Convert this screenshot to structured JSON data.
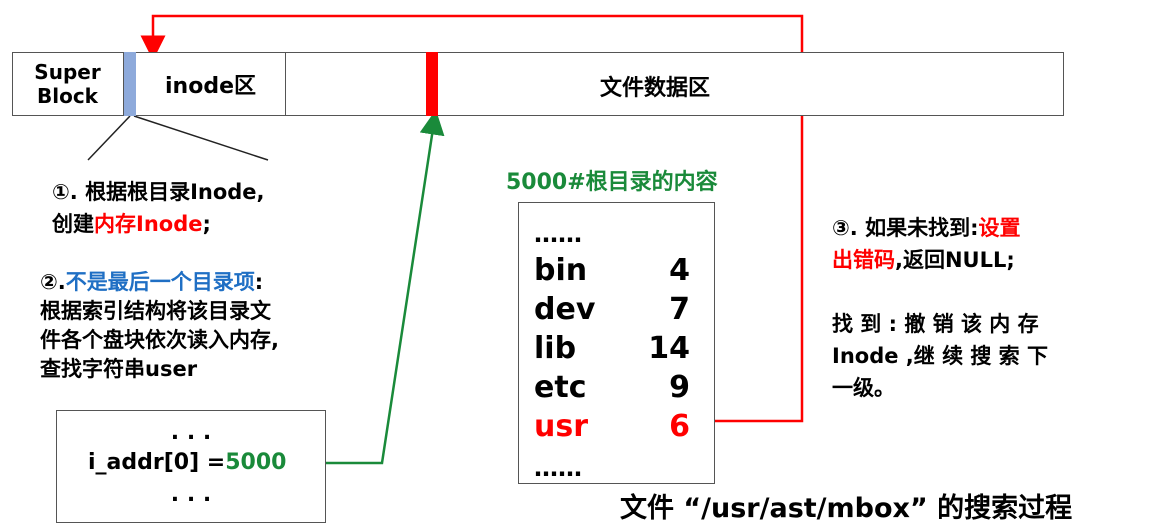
{
  "disk": {
    "superblock": "Super\nBlock",
    "inode_area": "inode区",
    "data_area": "文件数据区"
  },
  "step1": {
    "line1": "①. 根据根目录Inode,",
    "line2_prefix": "创建",
    "line2_red": "内存Inode",
    "line2_suffix": ";"
  },
  "step2": {
    "title_prefix": "②.",
    "title_blue": "不是最后一个目录项",
    "title_suffix": ":",
    "line1": "根据索引结构将该目录文",
    "line2": "件各个盘块依次读入内存,",
    "line3": "查找字符串user"
  },
  "inode_box": {
    "dots_top": ". . .",
    "addr_label": "i_addr[0] =",
    "addr_value": "5000",
    "dots_bottom": ". . ."
  },
  "dir_title": "5000#根目录的内容",
  "dir_entries": [
    {
      "name": "……",
      "num": ""
    },
    {
      "name": "bin",
      "num": "4"
    },
    {
      "name": "dev",
      "num": "7"
    },
    {
      "name": "lib",
      "num": "14"
    },
    {
      "name": "etc",
      "num": "9"
    },
    {
      "name": "usr",
      "num": "6"
    },
    {
      "name": "……",
      "num": ""
    }
  ],
  "step3": {
    "line1_prefix": "③. 如果未找到:",
    "line1_red": "设置",
    "line2_red": "出错码",
    "line2_suffix": ",返回NULL;",
    "found1": "找 到 : 撤 销 该 内 存",
    "found2": "Inode ,继 续 搜 索 下",
    "found3": "一级。"
  },
  "footer": "文件 “/usr/ast/mbox” 的搜索过程",
  "colors": {
    "red": "#ff0000",
    "green": "#1a8a3a",
    "blue": "#1f6fc4",
    "highlight_block": "#8eaadb"
  }
}
